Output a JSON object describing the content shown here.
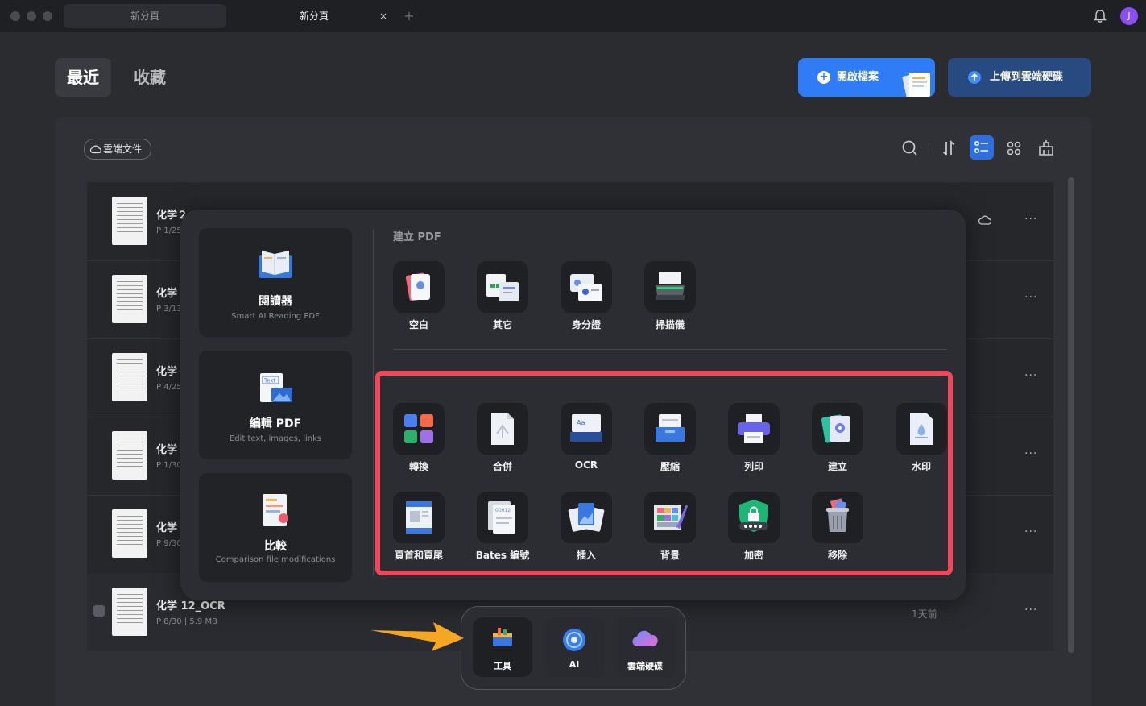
{
  "titlebar": {
    "tabs": [
      {
        "label": "新分頁",
        "active": false
      },
      {
        "label": "新分頁",
        "active": true
      }
    ],
    "close_glyph": "×",
    "add_glyph": "+",
    "avatar_initial": "J"
  },
  "header": {
    "tabs": [
      {
        "label": "最近"
      },
      {
        "label": "收藏"
      }
    ],
    "open_file_label": "開啟檔案",
    "upload_label": "上傳到雲端硬碟"
  },
  "toolbar": {
    "cloud_chip_label": "雲端文件",
    "icons": [
      "search-icon",
      "sort-icon",
      "list-view-icon",
      "grid-view-icon",
      "clean-icon"
    ]
  },
  "files": [
    {
      "name": "化学２",
      "meta": "P 1/25"
    },
    {
      "name": "化学",
      "meta": "P 3/13"
    },
    {
      "name": "化学",
      "meta": "P 4/25"
    },
    {
      "name": "化学",
      "meta": "P 1/30"
    },
    {
      "name": "化学",
      "meta": "P 9/30"
    },
    {
      "name": "化学 12_OCR",
      "meta": "P 8/30 | 5.9 MB",
      "time": "1天前"
    }
  ],
  "popup": {
    "side_cards": [
      {
        "title": "閱讀器",
        "subtitle": "Smart AI Reading PDF"
      },
      {
        "title": "編輯 PDF",
        "subtitle": "Edit text, images, links"
      },
      {
        "title": "比較",
        "subtitle": "Comparison file modifications"
      }
    ],
    "create_section_title": "建立 PDF",
    "create_tools": [
      {
        "label": "空白",
        "icon": "blank-page-icon"
      },
      {
        "label": "其它",
        "icon": "other-files-icon"
      },
      {
        "label": "身分證",
        "icon": "id-card-icon"
      },
      {
        "label": "掃描儀",
        "icon": "scanner-icon"
      }
    ],
    "tools_row1": [
      {
        "label": "轉換",
        "icon": "convert-icon"
      },
      {
        "label": "合併",
        "icon": "merge-icon"
      },
      {
        "label": "OCR",
        "icon": "ocr-icon"
      },
      {
        "label": "壓縮",
        "icon": "compress-icon"
      },
      {
        "label": "列印",
        "icon": "print-icon"
      },
      {
        "label": "建立",
        "icon": "create-icon"
      },
      {
        "label": "水印",
        "icon": "watermark-icon"
      }
    ],
    "tools_row2": [
      {
        "label": "頁首和頁尾",
        "icon": "header-footer-icon"
      },
      {
        "label": "Bates 編號",
        "icon": "bates-number-icon"
      },
      {
        "label": "插入",
        "icon": "insert-icon"
      },
      {
        "label": "背景",
        "icon": "background-icon"
      },
      {
        "label": "加密",
        "icon": "encrypt-icon"
      },
      {
        "label": "移除",
        "icon": "remove-icon"
      }
    ],
    "highlight_color": "#f0485a"
  },
  "dock": [
    {
      "label": "工具",
      "icon": "toolbox-icon"
    },
    {
      "label": "AI",
      "icon": "ai-icon"
    },
    {
      "label": "雲端硬碟",
      "icon": "cloud-drive-icon"
    }
  ],
  "colors": {
    "accent": "#2f7cf6",
    "upload_btn": "#274a80",
    "arrow": "#f5a623"
  }
}
